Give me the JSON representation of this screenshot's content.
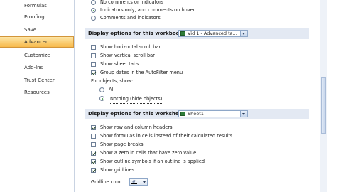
{
  "sidebar": {
    "items": [
      {
        "label": "Formulas",
        "active": false
      },
      {
        "label": "Proofing",
        "active": false
      },
      {
        "label": "Save",
        "active": false
      },
      {
        "label": "Advanced",
        "active": true
      },
      {
        "label": "Customize",
        "active": false
      },
      {
        "label": "Add-Ins",
        "active": false
      },
      {
        "label": "Trust Center",
        "active": false
      },
      {
        "label": "Resources",
        "active": false
      }
    ]
  },
  "comments": {
    "options": [
      {
        "label": "No comments or indicators",
        "checked": false
      },
      {
        "label": "Indicators only, and comments on hover",
        "checked": true
      },
      {
        "label": "Comments and indicators",
        "checked": false
      }
    ]
  },
  "workbook": {
    "header": "Display options for this workbook:",
    "selected": "Vid 1 - Advanced ta...",
    "options": [
      {
        "label": "Show horizontal scroll bar",
        "checked": false
      },
      {
        "label": "Show vertical scroll bar",
        "checked": false
      },
      {
        "label": "Show sheet tabs",
        "checked": false
      },
      {
        "label": "Group dates in the AutoFilter menu",
        "checked": true
      }
    ],
    "objects_label": "For objects, show:",
    "objects": [
      {
        "label": "All",
        "checked": false
      },
      {
        "label": "Nothing (hide objects)",
        "checked": true
      }
    ]
  },
  "worksheet": {
    "header": "Display options for this worksheet:",
    "selected": "Sheet1",
    "options": [
      {
        "label": "Show row and column headers",
        "checked": true
      },
      {
        "label": "Show formulas in cells instead of their calculated results",
        "checked": false
      },
      {
        "label": "Show page breaks",
        "checked": false
      },
      {
        "label": "Show a zero in cells that have zero value",
        "checked": true
      },
      {
        "label": "Show outline symbols if an outline is applied",
        "checked": true
      },
      {
        "label": "Show gridlines",
        "checked": true
      }
    ],
    "gridline_color_label": "Gridline color"
  },
  "colors": {
    "active_nav": "#f7b94a",
    "section_header": "#e3e9f3",
    "gridline_color": "#000000"
  }
}
